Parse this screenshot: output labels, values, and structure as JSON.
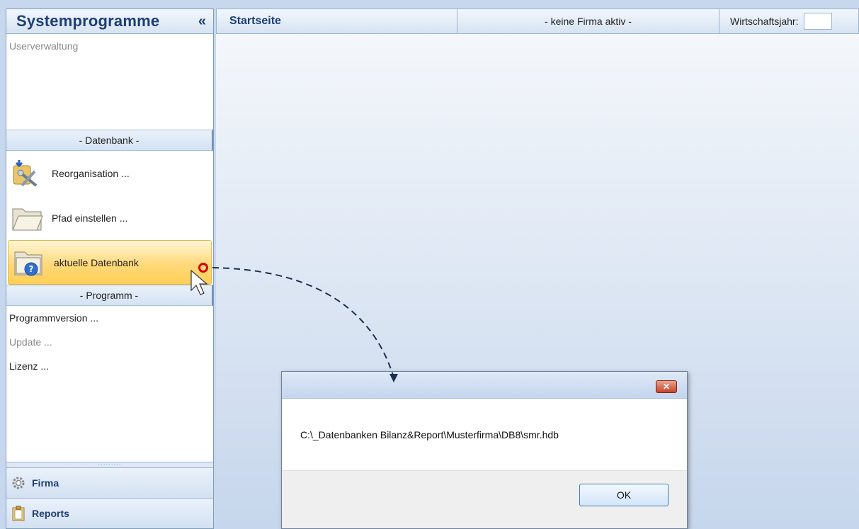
{
  "sidebar": {
    "title": "Systemprogramme",
    "collapse_glyph": "«",
    "user_item": "Userverwaltung",
    "groups": {
      "datenbank": "- Datenbank -",
      "programm": "- Programm -"
    },
    "datenbank_items": [
      {
        "label": "Reorganisation ...",
        "icon": "reorganisation-icon"
      },
      {
        "label": "Pfad einstellen ...",
        "icon": "folder-icon"
      },
      {
        "label": "aktuelle Datenbank",
        "icon": "database-info-icon"
      }
    ],
    "programm_items": [
      {
        "label": "Programmversion ...",
        "enabled": true
      },
      {
        "label": "Update ...",
        "enabled": false
      },
      {
        "label": "Lizenz ...",
        "enabled": true
      }
    ],
    "nav_buttons": [
      {
        "label": "Firma",
        "icon": "gear-icon"
      },
      {
        "label": "Reports",
        "icon": "clipboard-icon"
      }
    ]
  },
  "topbar": {
    "start": "Startseite",
    "firma": "- keine Firma aktiv -",
    "wirtschaftsjahr_label": "Wirtschaftsjahr:"
  },
  "dialog": {
    "message": "C:\\_Datenbanken Bilanz&Report\\Musterfirma\\DB8\\smr.hdb",
    "close_glyph": "✕",
    "ok_label": "OK"
  },
  "colors": {
    "accent_highlight": "#ffd97a",
    "arrow": "#1e3050",
    "marker": "#d40000"
  }
}
